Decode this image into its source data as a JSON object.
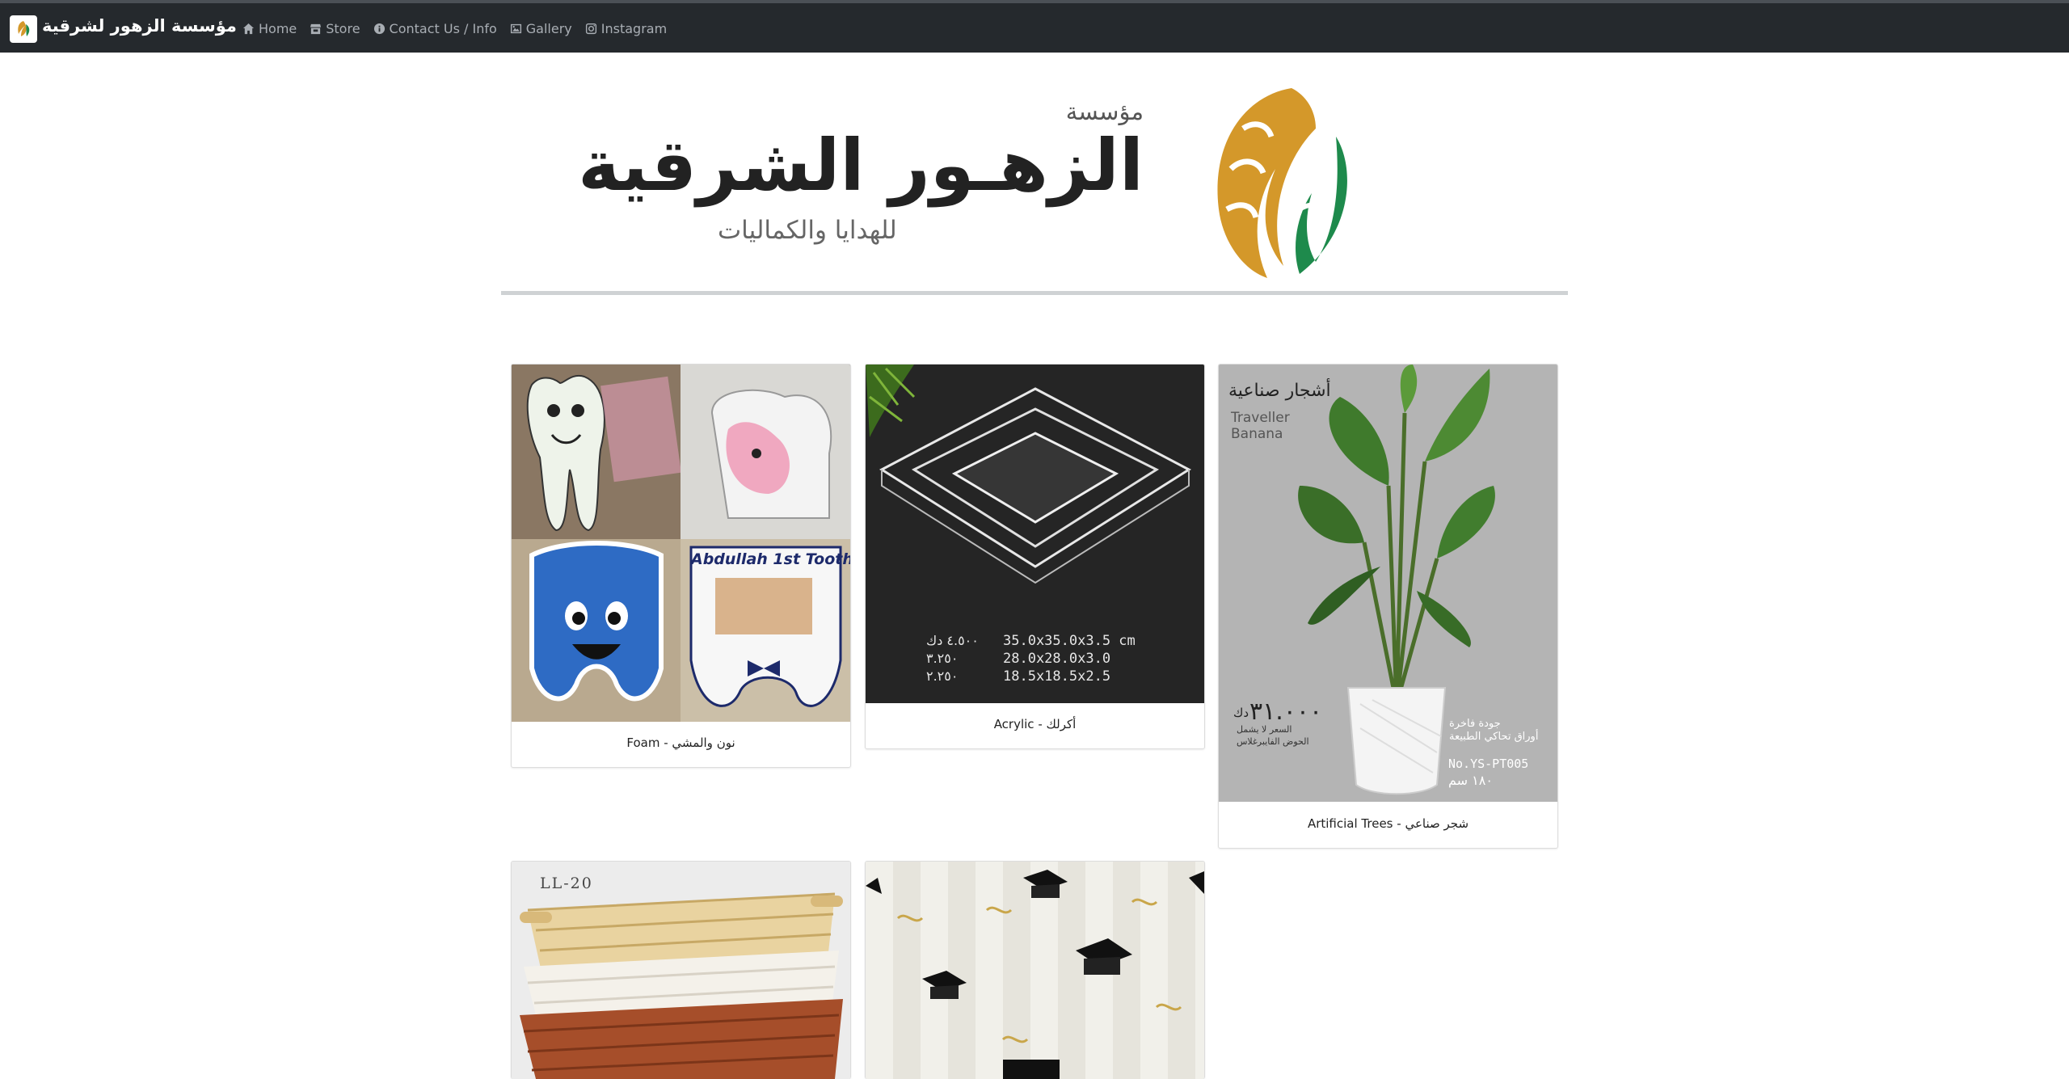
{
  "navbar": {
    "brand": "مؤسسة الزهور لشرقية",
    "links": [
      {
        "label": "Home",
        "icon": "home-icon"
      },
      {
        "label": "Store",
        "icon": "store-icon"
      },
      {
        "label": "Contact Us / Info",
        "icon": "info-icon"
      },
      {
        "label": "Gallery",
        "icon": "image-icon"
      },
      {
        "label": "Instagram",
        "icon": "instagram-icon"
      }
    ]
  },
  "banner": {
    "small_text": "مؤسسة",
    "big_text": "الزهـور الشرقية",
    "sub_text": "للهدايا والكماليات"
  },
  "products": [
    {
      "caption": "نون والمشي - Foam",
      "image_text": {
        "tooth_label": "Abdullah 1st Tooth!"
      }
    },
    {
      "caption": "أكرلك - Acrylic",
      "image_text": {
        "rows": [
          {
            "size": "35.0x35.0x3.5 cm",
            "price": "٤.٥٠٠ دك"
          },
          {
            "size": "28.0x28.0x3.0",
            "price": "٣.٢٥٠"
          },
          {
            "size": "18.5x18.5x2.5",
            "price": "٢.٢٥٠"
          }
        ]
      }
    },
    {
      "caption": "شجر صناعي - Artificial Trees",
      "image_text": {
        "title": "أشجار صناعية",
        "name_line1": "Traveller",
        "name_line2": "Banana",
        "price": "٣١.٠٠٠",
        "currency": "دك",
        "note_line1": "السعر لا يشمل",
        "note_line2": "الحوض الفايبرغلاس",
        "quality_line1": "جودة فاخرة",
        "quality_line2": "أوراق تحاكي الطبيعة",
        "code": "No.YS-PT005",
        "height": "١٨٠ سم"
      }
    },
    {
      "caption": "",
      "image_text": {
        "code": "LL-20"
      }
    },
    {
      "caption": "",
      "image_text": {}
    }
  ],
  "colors": {
    "navbar_bg": "#25292d",
    "nav_link": "#a9aeb4",
    "logo_gold": "#d4982a",
    "logo_green": "#1e8a4c"
  }
}
